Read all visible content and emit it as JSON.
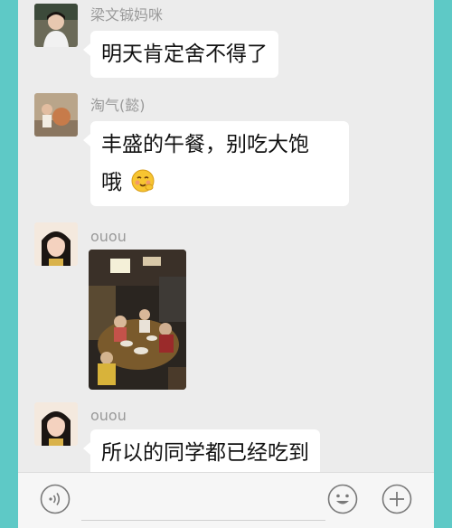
{
  "messages": [
    {
      "sender": "梁文铖妈咪",
      "text": "明天肯定舍不得了"
    },
    {
      "sender": "淘气(懿)",
      "text_line1": "丰盛的午餐，别吃大饱",
      "text_line2": "哦",
      "emoji": "shy-smile-emoji"
    },
    {
      "sender": "ouou",
      "content": "photo"
    },
    {
      "sender": "ouou",
      "text": "所以的同学都已经吃到"
    }
  ],
  "input_bar": {
    "voice_icon": "voice-icon",
    "emoji_icon": "emoji-icon",
    "plus_icon": "plus-icon"
  },
  "colors": {
    "frame": "#5ec9c6",
    "chat_bg": "#ececec",
    "bubble": "#ffffff",
    "sender_text": "#9a9a9a"
  }
}
